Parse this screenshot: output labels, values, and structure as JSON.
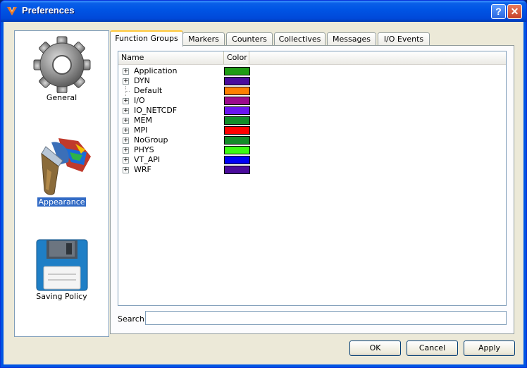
{
  "window": {
    "title": "Preferences",
    "help_glyph": "?",
    "close_glyph": "✕",
    "icon": "app-logo-icon"
  },
  "sidebar": {
    "items": [
      {
        "label": "General",
        "icon": "gear-icon",
        "selected": false
      },
      {
        "label": "Appearance",
        "icon": "paint-brush-icon",
        "selected": true
      },
      {
        "label": "Saving Policy",
        "icon": "floppy-disk-icon",
        "selected": false
      }
    ]
  },
  "tabs": [
    "Function Groups",
    "Markers",
    "Counters",
    "Collectives",
    "Messages",
    "I/O Events"
  ],
  "active_tab": "Function Groups",
  "table": {
    "columns": [
      "Name",
      "Color"
    ],
    "rows": [
      {
        "name": "Application",
        "color": "#1e9c14",
        "expandable": true
      },
      {
        "name": "DYN",
        "color": "#4b0c9c",
        "expandable": true
      },
      {
        "name": "Default",
        "color": "#ff7f00",
        "expandable": false
      },
      {
        "name": "I/O",
        "color": "#9c0a8c",
        "expandable": true
      },
      {
        "name": "IO_NETCDF",
        "color": "#6a14f0",
        "expandable": true
      },
      {
        "name": "MEM",
        "color": "#128c28",
        "expandable": true
      },
      {
        "name": "MPI",
        "color": "#ff0000",
        "expandable": true
      },
      {
        "name": "NoGroup",
        "color": "#128c28",
        "expandable": true
      },
      {
        "name": "PHYS",
        "color": "#3cfa14",
        "expandable": true
      },
      {
        "name": "VT_API",
        "color": "#0000f5",
        "expandable": true
      },
      {
        "name": "WRF",
        "color": "#4b0c9c",
        "expandable": true
      }
    ]
  },
  "search": {
    "label": "Search",
    "value": ""
  },
  "buttons": {
    "ok": "OK",
    "cancel": "Cancel",
    "apply": "Apply"
  },
  "colors": {
    "titlebar": "#0055e5",
    "selection": "#316ac5",
    "tab_highlight": "#ffc83c",
    "dialog_bg": "#ece9d8"
  }
}
